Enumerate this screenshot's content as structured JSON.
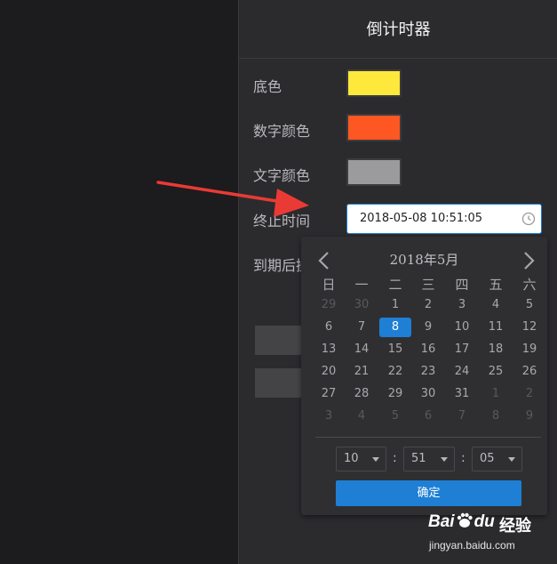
{
  "panel": {
    "title": "倒计时器",
    "fields": {
      "bg_color_label": "底色",
      "number_color_label": "数字颜色",
      "text_color_label": "文字颜色",
      "end_time_label": "终止时间",
      "after_expire_label": "到期后操"
    },
    "colors": {
      "bg": "#ffe83c",
      "number": "#ff5722",
      "text": "#9b9a9d",
      "accent": "#1e7fd4"
    },
    "end_time_value": "2018-05-08 10:51:05"
  },
  "calendar": {
    "title": "2018年5月",
    "weekdays": [
      "日",
      "一",
      "二",
      "三",
      "四",
      "五",
      "六"
    ],
    "rows": [
      [
        "29",
        "30",
        "1",
        "2",
        "3",
        "4",
        "5"
      ],
      [
        "6",
        "7",
        "8",
        "9",
        "10",
        "11",
        "12"
      ],
      [
        "13",
        "14",
        "15",
        "16",
        "17",
        "18",
        "19"
      ],
      [
        "20",
        "21",
        "22",
        "23",
        "24",
        "25",
        "26"
      ],
      [
        "27",
        "28",
        "29",
        "30",
        "31",
        "1",
        "2"
      ],
      [
        "3",
        "4",
        "5",
        "6",
        "7",
        "8",
        "9"
      ]
    ],
    "hour": "10",
    "minute": "51",
    "second": "05",
    "separator": ":",
    "confirm_label": "确定"
  },
  "watermark": {
    "brand": "Bai",
    "brand_tail": "du",
    "cn": "经验",
    "url": "jingyan.baidu.com"
  }
}
